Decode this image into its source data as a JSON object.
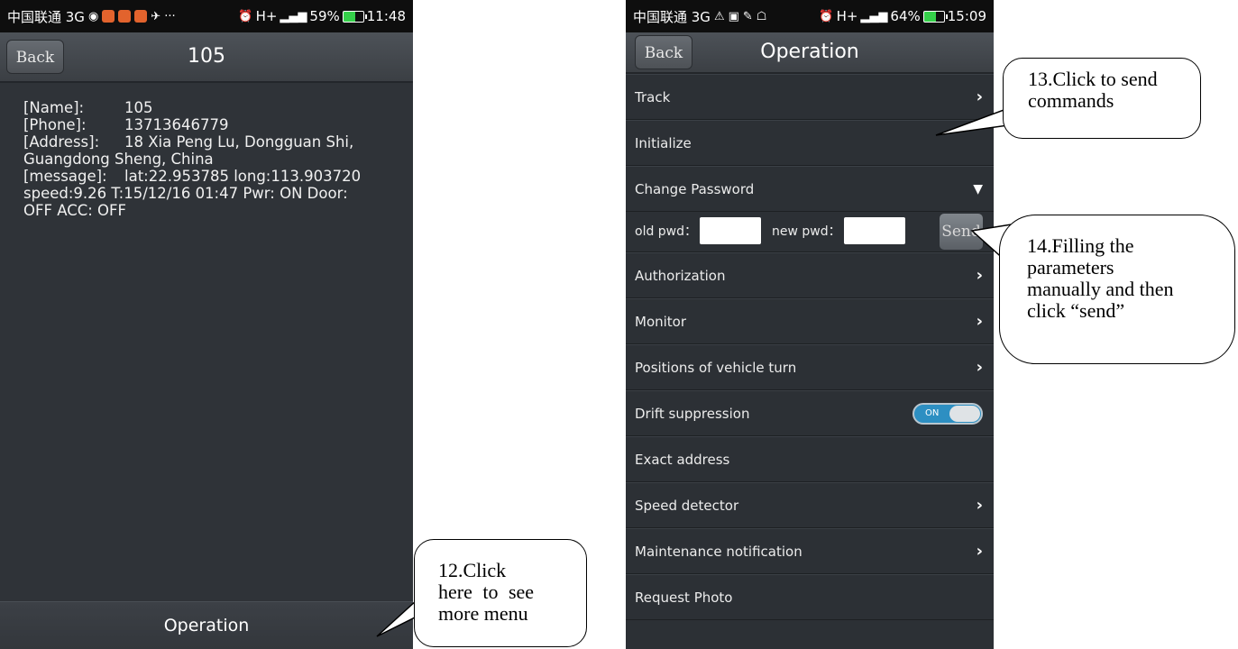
{
  "screen1": {
    "status": {
      "carrier": "中国联通 3G",
      "net": "H+",
      "battery": "59%",
      "time": "11:48"
    },
    "back_label": "Back",
    "title": "105",
    "info": {
      "name_key": "[Name]:",
      "name_val": "105",
      "phone_key": "[Phone]:",
      "phone_val": "13713646779",
      "address_key": "[Address]:",
      "address_val": "18 Xia Peng Lu, Dongguan Shi,",
      "address_cont": "Guangdong Sheng, China",
      "message_key": "[message]:",
      "message_val": "lat:22.953785 long:113.903720",
      "message_cont1": "speed:9.26  T:15/12/16 01:47  Pwr: ON Door:",
      "message_cont2": "OFF ACC: OFF"
    },
    "operation_label": "Operation"
  },
  "screen2": {
    "status": {
      "carrier": "中国联通 3G",
      "net": "H+",
      "battery": "64%",
      "time": "15:09"
    },
    "back_label": "Back",
    "title": "Operation",
    "menu": {
      "track": "Track",
      "initialize": "Initialize",
      "change_password": "Change Password",
      "old_pwd_label": "old pwd：",
      "new_pwd_label": "new pwd：",
      "send_label": "Send",
      "authorization": "Authorization",
      "monitor": "Monitor",
      "positions": "Positions of vehicle turn",
      "drift": "Drift suppression",
      "drift_toggle": "ON",
      "exact_address": "Exact address",
      "speed_detector": "Speed detector",
      "maintenance": "Maintenance notification",
      "request_photo": "Request Photo"
    }
  },
  "callouts": {
    "c12_line1": "12.Click",
    "c12_line2": "here to see",
    "c12_line3": "more menu",
    "c13_line1": "13.Click to send",
    "c13_line2": "commands",
    "c14_line1": "14.Filling the",
    "c14_line2": "parameters",
    "c14_line3": "manually and then",
    "c14_line4": "click “send”"
  }
}
